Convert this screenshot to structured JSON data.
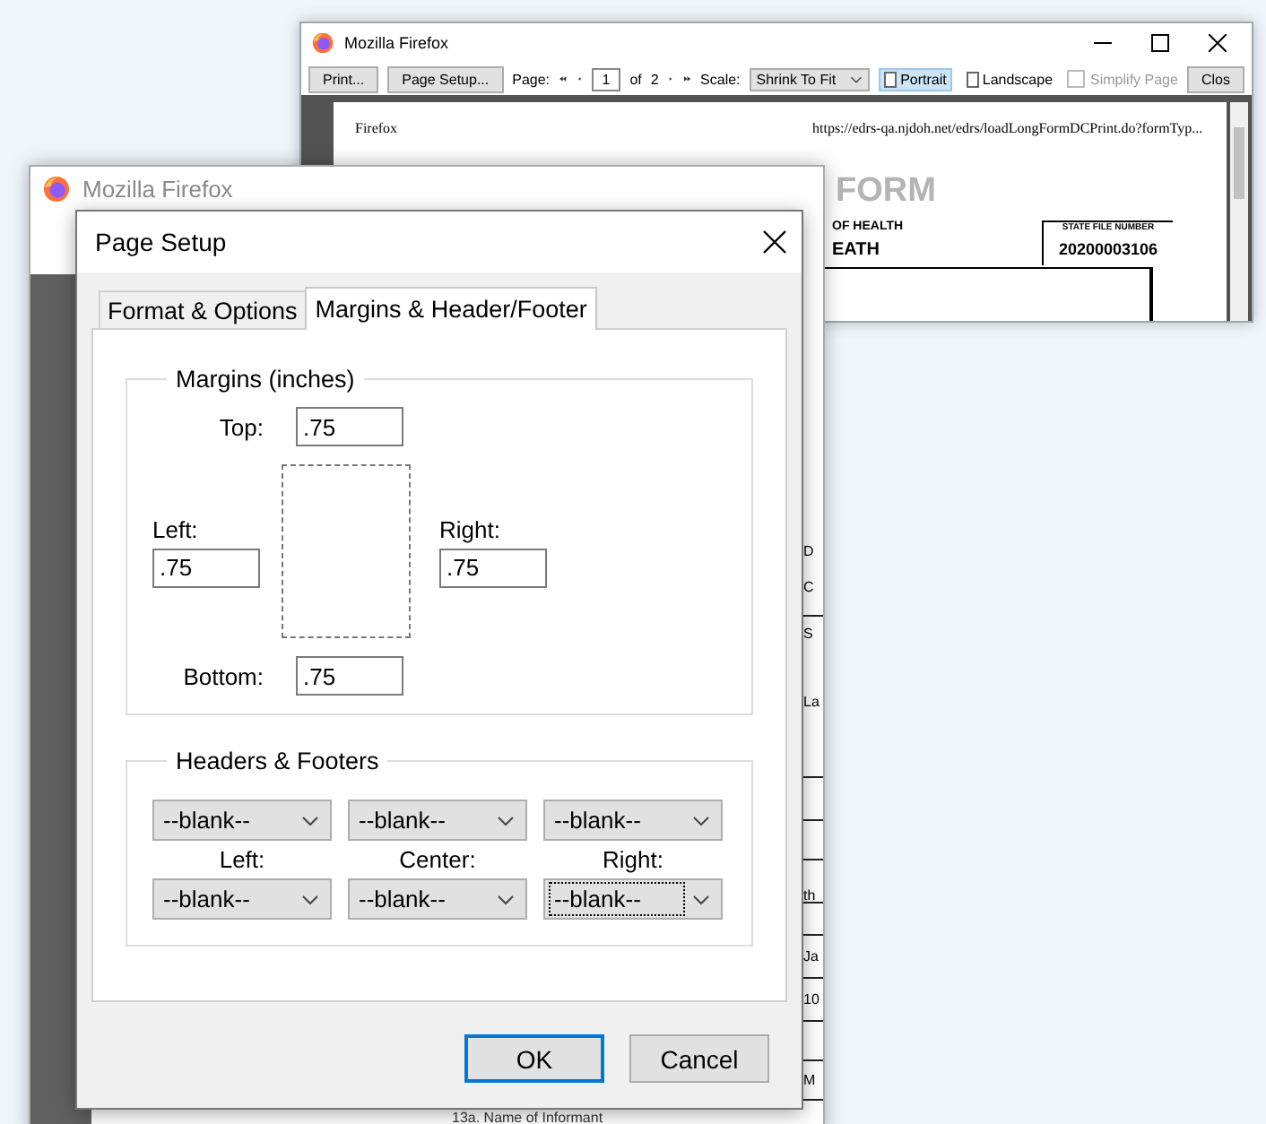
{
  "back_window": {
    "title": "Mozilla Firefox",
    "toolbar": [
      {
        "kind": "button",
        "label": "Print..."
      },
      {
        "kind": "button",
        "label": "Page Setup..."
      },
      {
        "kind": "label",
        "label": "Page:"
      },
      {
        "kind": "first"
      },
      {
        "kind": "prev"
      },
      {
        "kind": "field",
        "label": "1"
      },
      {
        "kind": "label",
        "label": "of"
      },
      {
        "kind": "label",
        "label": "2"
      },
      {
        "kind": "next"
      },
      {
        "kind": "last"
      },
      {
        "kind": "label",
        "label": "Scale:"
      },
      {
        "kind": "select",
        "label": "Shrink To Fit"
      },
      {
        "kind": "toggle",
        "label": "Portrait",
        "selected": true
      },
      {
        "kind": "toggle",
        "label": "Landscape",
        "selected": false
      },
      {
        "kind": "checkbox",
        "label": "Simplify Page",
        "checked": false
      },
      {
        "kind": "button",
        "label": "Clos"
      }
    ],
    "page": {
      "header_left": "Firefox",
      "header_right": "https://edrs-qa.njdoh.net/edrs/loadLongFormDCPrint.do?formTyp...",
      "watermark": "FORM",
      "department": "OF HEALTH",
      "form_title": "EATH",
      "state_file_label": "STATE FILE NUMBER",
      "state_file_number": "20200003106"
    }
  },
  "front_window": {
    "title": "Mozilla Firefox",
    "page_fragments": [
      "D",
      "C",
      "S",
      "La",
      "th",
      "Ja",
      "10",
      "M"
    ],
    "page_footer": "13a. Name of Informant"
  },
  "dialog": {
    "title": "Page Setup",
    "tabs": [
      {
        "label": "Format & Options",
        "selected": false
      },
      {
        "label": "Margins & Header/Footer",
        "selected": true
      }
    ],
    "margins": {
      "legend": "Margins (inches)",
      "top": {
        "label": "Top:",
        "value": ".75"
      },
      "left": {
        "label": "Left:",
        "value": ".75"
      },
      "right": {
        "label": "Right:",
        "value": ".75"
      },
      "bottom": {
        "label": "Bottom:",
        "value": ".75"
      }
    },
    "headers_footers": {
      "legend": "Headers & Footers",
      "headers": [
        {
          "value": "--blank--",
          "focused": false
        },
        {
          "value": "--blank--",
          "focused": false
        },
        {
          "value": "--blank--",
          "focused": false
        }
      ],
      "labels": [
        "Left:",
        "Center:",
        "Right:"
      ],
      "footers": [
        {
          "value": "--blank--",
          "focused": false
        },
        {
          "value": "--blank--",
          "focused": false
        },
        {
          "value": "--blank--",
          "focused": true
        }
      ]
    },
    "buttons": [
      {
        "label": "OK",
        "default": true
      },
      {
        "label": "Cancel",
        "default": false
      }
    ]
  }
}
